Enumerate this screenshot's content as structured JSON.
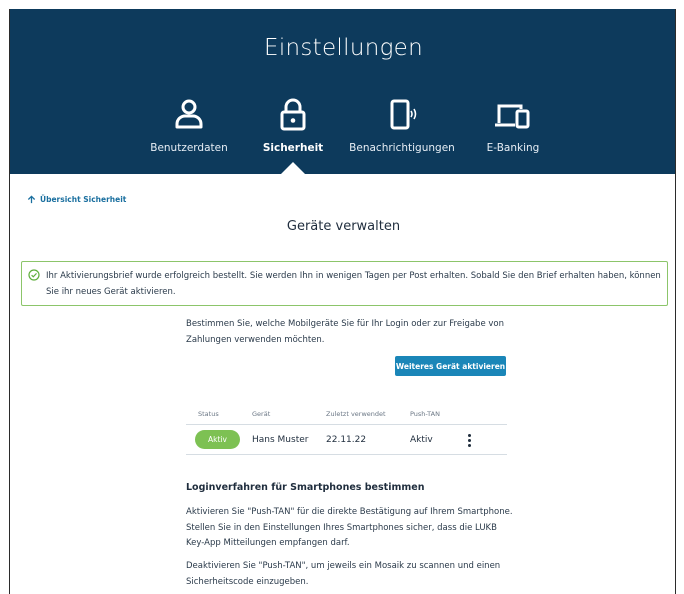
{
  "header": {
    "title": "Einstellungen",
    "nav": [
      {
        "label": "Benutzerdaten",
        "icon": "user-icon",
        "active": false
      },
      {
        "label": "Sicherheit",
        "icon": "lock-icon",
        "active": true
      },
      {
        "label": "Benachrichtigungen",
        "icon": "phone-notification-icon",
        "active": false
      },
      {
        "label": "E-Banking",
        "icon": "devices-icon",
        "active": false
      }
    ]
  },
  "back_link": {
    "label": "Übersicht Sicherheit",
    "icon": "arrow-up-icon"
  },
  "page_title": "Geräte verwalten",
  "alert": {
    "icon": "check-circle-icon",
    "text": "Ihr Aktivierungsbrief wurde erfolgreich bestellt. Sie werden Ihn in wenigen Tagen per Post erhalten. Sobald Sie den Brief erhalten haben, können Sie ihr neues Gerät aktivieren."
  },
  "intro": "Bestimmen Sie, welche Mobilgeräte Sie für Ihr Login oder zur Freigabe von Zahlungen verwenden möchten.",
  "activate_button": "Weiteres Gerät aktivieren",
  "table": {
    "headers": {
      "status": "Status",
      "device": "Gerät",
      "last_used": "Zuletzt verwendet",
      "push_tan": "Push-TAN"
    },
    "rows": [
      {
        "status": "Aktiv",
        "device": "Hans Muster",
        "last_used": "22.11.22",
        "push_tan": "Aktiv"
      }
    ]
  },
  "login_section": {
    "heading": "Loginverfahren für Smartphones bestimmen",
    "para1": "Aktivieren Sie \"Push-TAN\" für die direkte Bestätigung auf Ihrem Smartphone. Stellen Sie in den Einstellungen Ihres Smartphones sicher, dass die LUKB Key-App Mitteilungen empfangen darf.",
    "para2": "Deaktivieren Sie \"Push-TAN\", um jeweils ein Mosaik zu scannen und einen Sicherheitscode einzugeben."
  },
  "colors": {
    "header_bg": "#0d3a5c",
    "accent": "#1a86b8",
    "success": "#7dc153",
    "alert_border": "#8cc56a"
  }
}
